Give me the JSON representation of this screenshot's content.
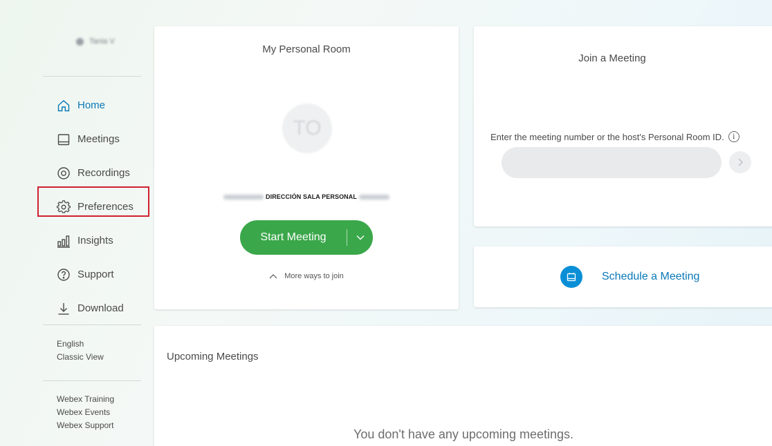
{
  "sidebar": {
    "user_name": "Tania V",
    "nav": [
      {
        "label": "Home",
        "icon": "home-icon",
        "active": true
      },
      {
        "label": "Meetings",
        "icon": "calendar-icon"
      },
      {
        "label": "Recordings",
        "icon": "recording-icon"
      },
      {
        "label": "Preferences",
        "icon": "gear-icon"
      },
      {
        "label": "Insights",
        "icon": "bar-chart-icon"
      },
      {
        "label": "Support",
        "icon": "question-icon"
      },
      {
        "label": "Download",
        "icon": "download-icon"
      }
    ],
    "language": "English",
    "classic_view": "Classic View",
    "links": [
      "Webex Training",
      "Webex Events",
      "Webex Support"
    ]
  },
  "personal_room": {
    "title": "My Personal Room",
    "avatar_initials": "TO",
    "url_label": "DIRECCIÓN SALA PERSONAL",
    "start_button": "Start Meeting",
    "more_ways": "More ways to join"
  },
  "join_meeting": {
    "title": "Join a Meeting",
    "prompt": "Enter the meeting number or the host's Personal Room ID.",
    "info_glyph": "i",
    "input_value": ""
  },
  "schedule": {
    "label": "Schedule a Meeting"
  },
  "upcoming": {
    "title": "Upcoming Meetings",
    "empty_text": "You don't have any upcoming meetings."
  },
  "colors": {
    "accent_blue": "#0a78b7",
    "start_green": "#3aa74a",
    "highlight_red": "#d0202f",
    "schedule_icon_blue": "#0a8fd6"
  }
}
